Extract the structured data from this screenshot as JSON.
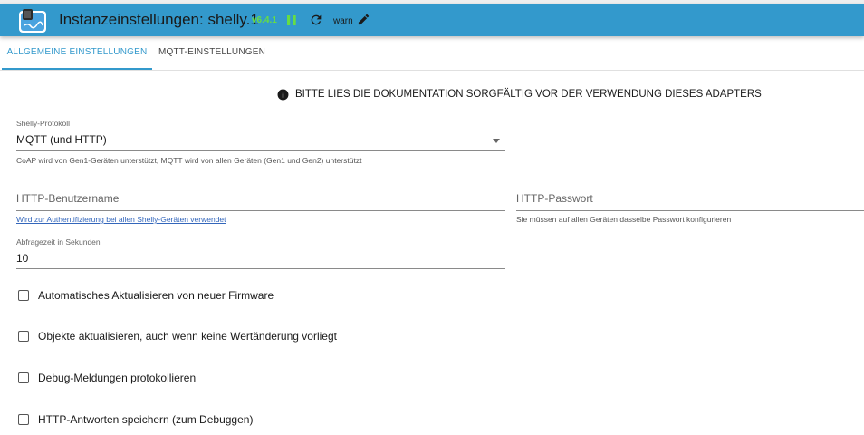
{
  "header": {
    "title": "Instanzeinstellungen: shelly.1",
    "version": "v6.4.1",
    "log_level": "warn"
  },
  "icons": {
    "logo": "shelly-adapter-logo",
    "pause": "pause-icon",
    "reload": "reload-icon",
    "edit": "pencil-icon",
    "info": "info-icon"
  },
  "tabs": [
    {
      "label": "ALLGEMEINE EINSTELLUNGEN",
      "active": true
    },
    {
      "label": "MQTT-EINSTELLUNGEN",
      "active": false
    }
  ],
  "notice": "BITTE LIES DIE DOKUMENTATION SORGFÄLTIG VOR DER VERWENDUNG DIESES ADAPTERS",
  "form": {
    "protocol": {
      "label": "Shelly-Protokoll",
      "value": "MQTT (und HTTP)",
      "helper": "CoAP wird von Gen1-Geräten unterstützt, MQTT wird von allen Geräten (Gen1 und Gen2) unterstützt"
    },
    "http_username": {
      "placeholder": "HTTP-Benutzername",
      "helper": "Wird zur Authentifizierung bei allen Shelly-Geräten verwendet"
    },
    "http_password": {
      "placeholder": "HTTP-Passwort",
      "helper": "Sie müssen auf allen Geräten dasselbe Passwort konfigurieren"
    },
    "poll_interval": {
      "label": "Abfragezeit in Sekunden",
      "value": "10"
    },
    "checkboxes": [
      {
        "label": "Automatisches Aktualisieren von neuer Firmware",
        "checked": false
      },
      {
        "label": "Objekte aktualisieren, auch wenn keine Wertänderung vorliegt",
        "checked": false
      },
      {
        "label": "Debug-Meldungen protokollieren",
        "checked": false
      },
      {
        "label": "HTTP-Antworten speichern (zum Debuggen)",
        "checked": false
      }
    ]
  },
  "colors": {
    "accent": "#3399cc",
    "version": "#66dd44"
  }
}
